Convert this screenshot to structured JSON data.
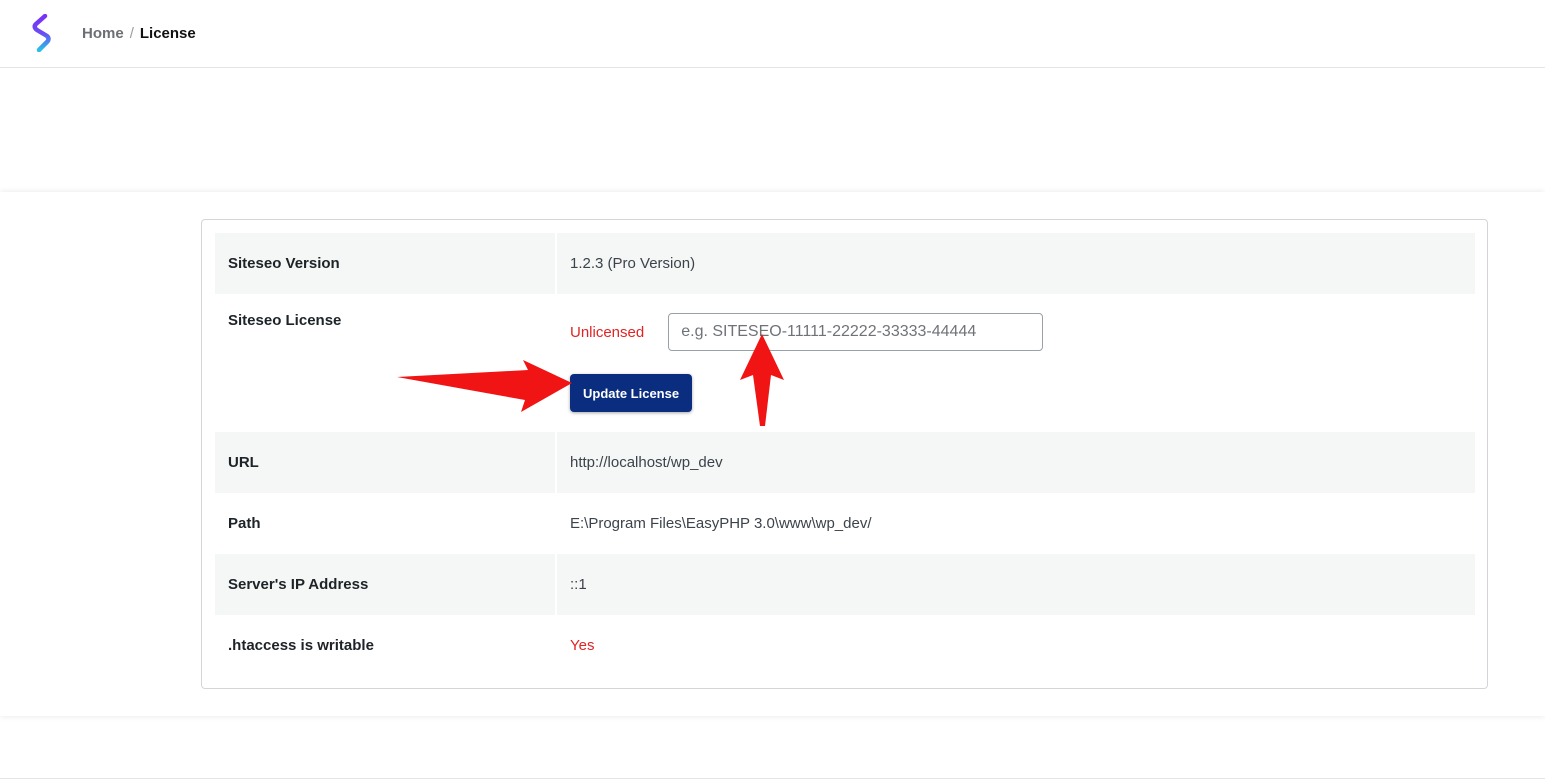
{
  "breadcrumb": {
    "home": "Home",
    "separator": "/",
    "current": "License"
  },
  "colors": {
    "accent_button": "#0a2d80",
    "warning_text": "#e02424",
    "annotation_arrow": "#f01414"
  },
  "info": {
    "version": {
      "label": "Siteseo Version",
      "value": "1.2.3 (Pro Version)"
    },
    "license": {
      "label": "Siteseo License",
      "status": "Unlicensed",
      "input_placeholder": "e.g. SITESEO-11111-22222-33333-44444",
      "input_value": "",
      "button_label": "Update License"
    },
    "url": {
      "label": "URL",
      "value": "http://localhost/wp_dev"
    },
    "path": {
      "label": "Path",
      "value": "E:\\Program Files\\EasyPHP 3.0\\www\\wp_dev/"
    },
    "ip": {
      "label": "Server's IP Address",
      "value": "::1"
    },
    "htaccess": {
      "label": ".htaccess is writable",
      "value": "Yes"
    }
  },
  "icons": {
    "logo": "siteseo-logo-icon",
    "arrow_right": "red-arrow-right-icon",
    "arrow_up": "red-arrow-up-icon"
  }
}
